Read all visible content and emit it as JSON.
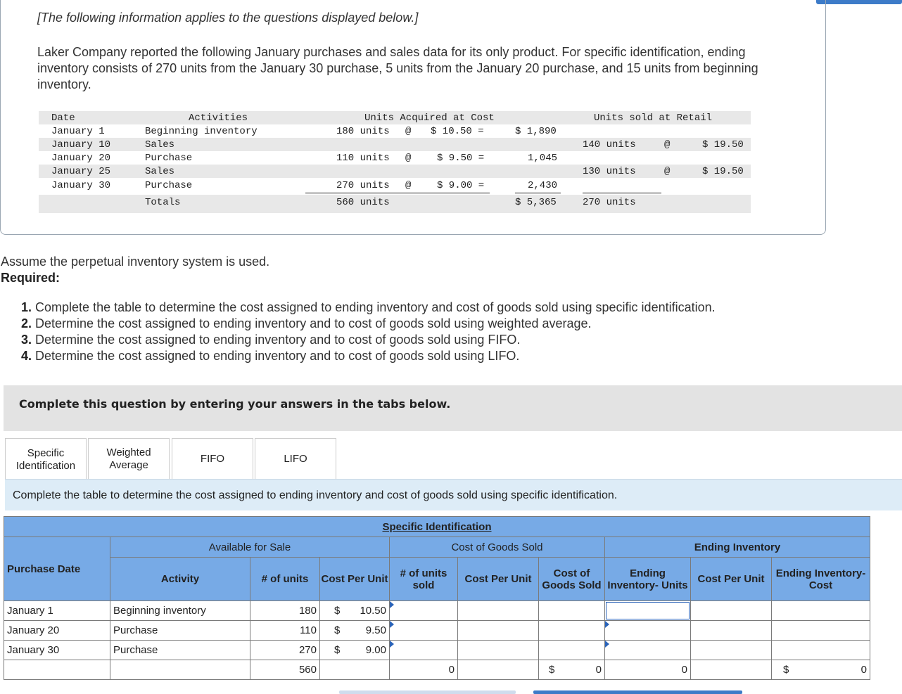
{
  "note": "[The following information applies to the questions displayed below.]",
  "intro": "Laker Company reported the following January purchases and sales data for its only product. For specific identification, ending inventory consists of 270 units from the January 30 purchase, 5 units from the January 20 purchase, and 15 units from beginning inventory.",
  "data_table": {
    "headers": {
      "date": "Date",
      "activities": "Activities",
      "acquired": "Units Acquired at Cost",
      "sold": "Units sold at Retail"
    },
    "rows": [
      {
        "date": "January 1",
        "activity": "Beginning inventory",
        "units": "180 units",
        "at": "@",
        "cost": "$ 10.50 =",
        "total": "$ 1,890",
        "sold_units": "",
        "sold_at": "",
        "price": ""
      },
      {
        "date": "January 10",
        "activity": "Sales",
        "units": "",
        "at": "",
        "cost": "",
        "total": "",
        "sold_units": "140 units",
        "sold_at": "@",
        "price": "$ 19.50"
      },
      {
        "date": "January 20",
        "activity": "Purchase",
        "units": "110 units",
        "at": "@",
        "cost": "$ 9.50 =",
        "total": "1,045",
        "sold_units": "",
        "sold_at": "",
        "price": ""
      },
      {
        "date": "January 25",
        "activity": "Sales",
        "units": "",
        "at": "",
        "cost": "",
        "total": "",
        "sold_units": "130 units",
        "sold_at": "@",
        "price": "$ 19.50"
      },
      {
        "date": "January 30",
        "activity": "Purchase",
        "units": "270 units",
        "at": "@",
        "cost": "$ 9.00 =",
        "total": "2,430",
        "sold_units": "",
        "sold_at": "",
        "price": ""
      }
    ],
    "totals": {
      "label": "Totals",
      "units": "560 units",
      "total": "$ 5,365",
      "sold_units": "270 units"
    }
  },
  "assume": "Assume the perpetual inventory system is used.",
  "required_label": "Required:",
  "requirements": [
    {
      "num": "1.",
      "text": "Complete the table to determine the cost assigned to ending inventory and cost of goods sold using specific identification."
    },
    {
      "num": "2.",
      "text": "Determine the cost assigned to ending inventory and to cost of goods sold using weighted average."
    },
    {
      "num": "3.",
      "text": "Determine the cost assigned to ending inventory and to cost of goods sold using FIFO."
    },
    {
      "num": "4.",
      "text": "Determine the cost assigned to ending inventory and to cost of goods sold using LIFO."
    }
  ],
  "complete_prompt": "Complete this question by entering your answers in the tabs below.",
  "tabs": [
    {
      "label": "Specific Identification"
    },
    {
      "label": "Weighted Average"
    },
    {
      "label": "FIFO"
    },
    {
      "label": "LIFO"
    }
  ],
  "tab_instruction": "Complete the table to determine the cost assigned to ending inventory and cost of goods sold using specific identification.",
  "grid": {
    "title": "Specific Identification",
    "groups": {
      "available": "Available for Sale",
      "cogs": "Cost of Goods Sold",
      "ending": "Ending Inventory"
    },
    "columns": {
      "purchase_date": "Purchase Date",
      "activity": "Activity",
      "units": "# of units",
      "cost_per_unit": "Cost Per Unit",
      "units_sold": "# of units sold",
      "cogs_cost_per_unit": "Cost Per Unit",
      "cogs": "Cost of Goods Sold",
      "ending_units": "Ending Inventory- Units",
      "ending_cost_per_unit": "Cost Per Unit",
      "ending_cost": "Ending Inventory- Cost"
    },
    "rows": [
      {
        "date": "January 1",
        "activity": "Beginning inventory",
        "units": "180",
        "dollar": "$",
        "cost": "10.50"
      },
      {
        "date": "January 20",
        "activity": "Purchase",
        "units": "110",
        "dollar": "$",
        "cost": "9.50"
      },
      {
        "date": "January 30",
        "activity": "Purchase",
        "units": "270",
        "dollar": "$",
        "cost": "9.00"
      }
    ],
    "totals": {
      "units": "560",
      "units_sold": "0",
      "cogs_dollar": "$",
      "cogs": "0",
      "ending_units": "0",
      "ending_dollar": "$",
      "ending_cost": "0"
    }
  }
}
